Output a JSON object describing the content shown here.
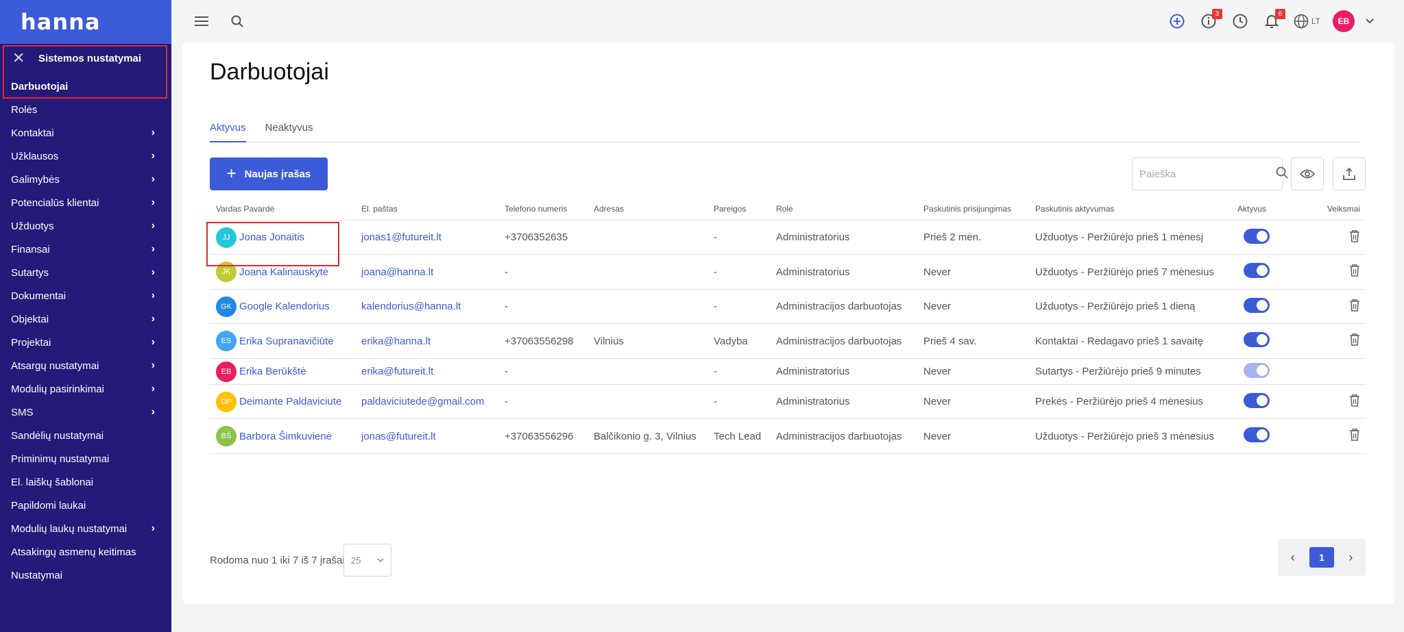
{
  "brand": "hanna",
  "sidebar": {
    "section_title": "Sistemos nustatymai",
    "items": [
      {
        "label": "Darbuotojai",
        "chevron": false,
        "active": true
      },
      {
        "label": "Rolės",
        "chevron": false
      },
      {
        "label": "Kontaktai",
        "chevron": true
      },
      {
        "label": "Užklausos",
        "chevron": true
      },
      {
        "label": "Galimybės",
        "chevron": true
      },
      {
        "label": "Potencialūs klientai",
        "chevron": true
      },
      {
        "label": "Užduotys",
        "chevron": true
      },
      {
        "label": "Finansai",
        "chevron": true
      },
      {
        "label": "Sutartys",
        "chevron": true
      },
      {
        "label": "Dokumentai",
        "chevron": true
      },
      {
        "label": "Objektai",
        "chevron": true
      },
      {
        "label": "Projektai",
        "chevron": true
      },
      {
        "label": "Atsargų nustatymai",
        "chevron": true
      },
      {
        "label": "Modulių pasirinkimai",
        "chevron": true
      },
      {
        "label": "SMS",
        "chevron": true
      },
      {
        "label": "Sandėlių nustatymai",
        "chevron": false
      },
      {
        "label": "Priminimų nustatymai",
        "chevron": false
      },
      {
        "label": "El. laiškų šablonai",
        "chevron": false
      },
      {
        "label": "Papildomi laukai",
        "chevron": false
      },
      {
        "label": "Modulių laukų nustatymai",
        "chevron": true
      },
      {
        "label": "Atsakingų asmenų keitimas",
        "chevron": false
      },
      {
        "label": "Nustatymai",
        "chevron": false
      }
    ]
  },
  "topbar": {
    "info_badge": "3",
    "notif_badge": "6",
    "language": "LT",
    "user_initials": "EB",
    "icons": [
      "menu-icon",
      "search-icon",
      "add-circle-icon",
      "info-icon",
      "clock-icon",
      "bell-icon",
      "globe-icon",
      "chevron-down-icon"
    ]
  },
  "page": {
    "title": "Darbuotojai",
    "tabs": [
      "Aktyvus",
      "Neaktyvus"
    ],
    "active_tab": "Aktyvus",
    "new_button": "Naujas įrašas",
    "search_placeholder": "Paieška"
  },
  "table": {
    "columns": [
      "Vardas Pavardė",
      "El. paštas",
      "Telefono numeris",
      "Adresas",
      "Pareigos",
      "Rolė",
      "Paskutinis prisijungimas",
      "Paskutinis aktyvumas",
      "Aktyvus",
      "Veiksmai"
    ],
    "rows": [
      {
        "initials": "JJ",
        "avatar_color": "#26c6da",
        "name": "Jonas Jonaitis",
        "email": "jonas1@futureit.lt",
        "phone": "+3706352635",
        "address": "",
        "position": "-",
        "role": "Administratorius",
        "last_login": "Prieš 2 mėn.",
        "last_activity": "Užduotys - Peržiūrėjo prieš 1 mėnesį",
        "active": true,
        "deletable": true
      },
      {
        "initials": "JK",
        "avatar_color": "#c0ca33",
        "name": "Joana Kalinauskytė",
        "email": "joana@hanna.lt",
        "phone": "-",
        "address": "",
        "position": "-",
        "role": "Administratorius",
        "last_login": "Never",
        "last_activity": "Užduotys - Peržiūrėjo prieš 7 mėnesius",
        "active": true,
        "deletable": true
      },
      {
        "initials": "GK",
        "avatar_color": "#1e88e5",
        "name": "Google Kalendorius",
        "email": "kalendorius@hanna.lt",
        "phone": "-",
        "address": "",
        "position": "-",
        "role": "Administracijos darbuotojas",
        "last_login": "Never",
        "last_activity": "Užduotys - Peržiūrėjo prieš 1 dieną",
        "active": true,
        "deletable": true
      },
      {
        "initials": "ES",
        "avatar_color": "#42a5f5",
        "name": "Erika Supranavičiūtė",
        "email": "erika@hanna.lt",
        "phone": "+37063556298",
        "address": "Vilnius",
        "position": "Vadyba",
        "role": "Administracijos darbuotojas",
        "last_login": "Prieš 4 sav.",
        "last_activity": "Kontaktai - Redagavo prieš 1 savaitę",
        "active": true,
        "deletable": true
      },
      {
        "initials": "EB",
        "avatar_color": "#e91e63",
        "name": "Erika Berūkštė",
        "email": "erika@futureit.lt",
        "phone": "-",
        "address": "",
        "position": "-",
        "role": "Administratorius",
        "last_login": "Never",
        "last_activity": "Sutartys - Peržiūrėjo prieš 9 minutes",
        "active": false,
        "deletable": false
      },
      {
        "initials": "DP",
        "avatar_color": "#ffc107",
        "name": "Deimante Paldaviciute",
        "email": "paldaviciutede@gmail.com",
        "phone": "-",
        "address": "",
        "position": "-",
        "role": "Administratorius",
        "last_login": "Never",
        "last_activity": "Prekės - Peržiūrėjo prieš 4 mėnesius",
        "active": true,
        "deletable": true
      },
      {
        "initials": "BŠ",
        "avatar_color": "#8bc34a",
        "name": "Barbora Šimkuvienė",
        "email": "jonas@futureit.lt",
        "phone": "+37063556296",
        "address": "Balčikonio g. 3, Vilnius",
        "position": "Tech Lead",
        "role": "Administracijos darbuotojas",
        "last_login": "Never",
        "last_activity": "Užduotys - Peržiūrėjo prieš 3 mėnesius",
        "active": true,
        "deletable": true
      }
    ]
  },
  "footer": {
    "summary": "Rodoma nuo 1 iki 7 iš 7 įrašai",
    "per_page": "25",
    "current_page": "1"
  }
}
